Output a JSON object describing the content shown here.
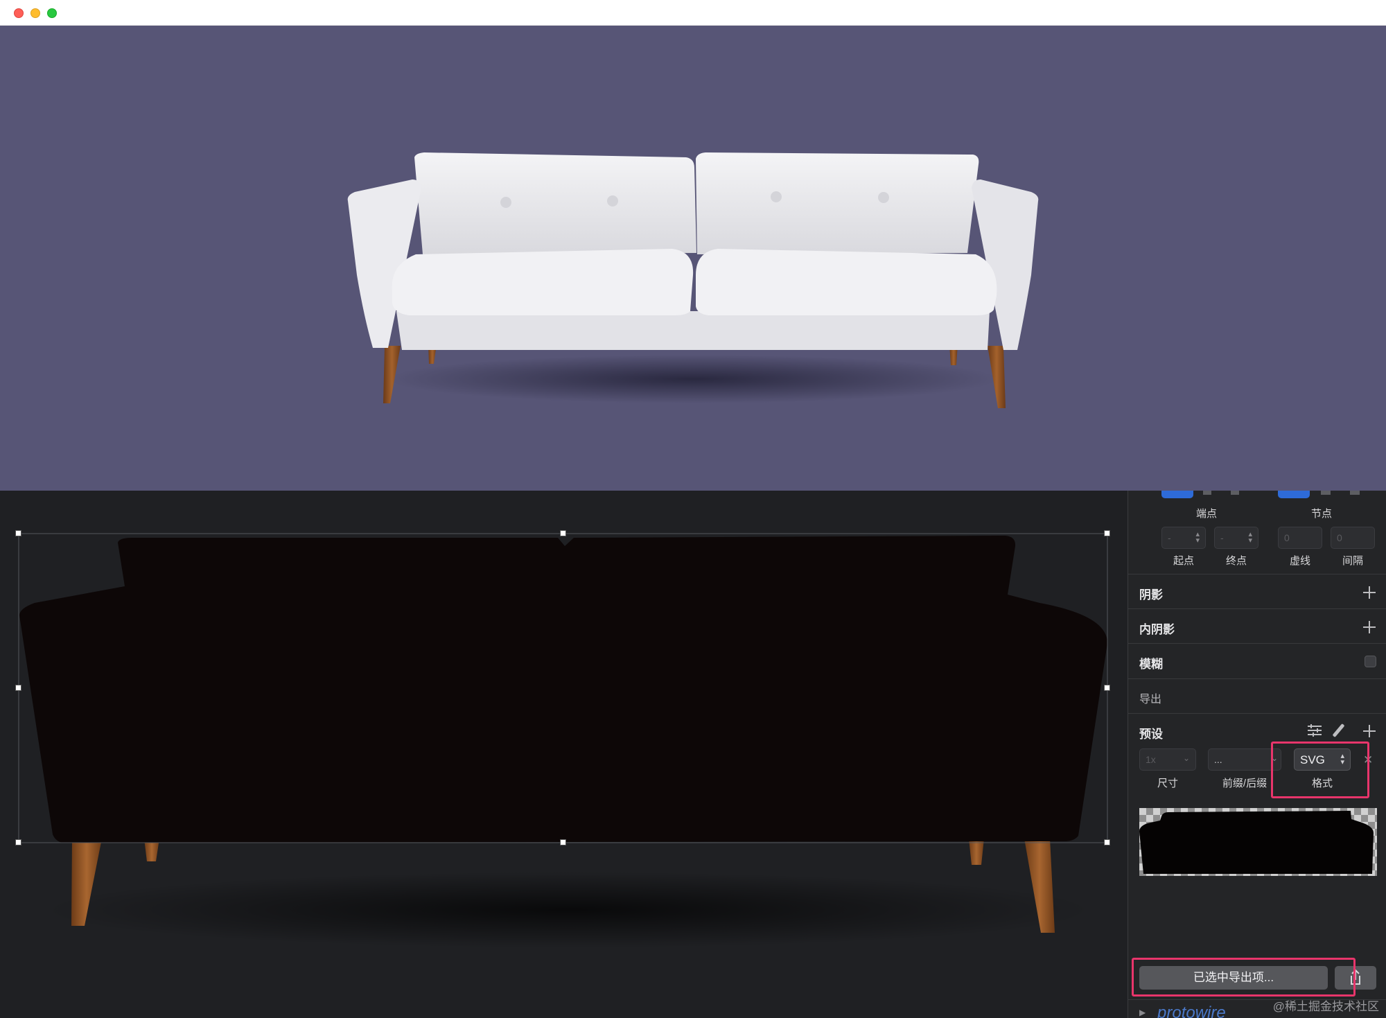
{
  "window": {
    "controls": [
      "close",
      "minimize",
      "maximize"
    ]
  },
  "preview": {
    "background_color": "#575576"
  },
  "inspector": {
    "border_row": {
      "endpoints_label": "端点",
      "nodes_label": "节点"
    },
    "dash_row": {
      "start_label": "起点",
      "start_value": "-",
      "end_label": "终点",
      "end_value": "-",
      "dash_label": "虚线",
      "dash_value": "0",
      "gap_label": "间隔",
      "gap_value": "0"
    },
    "shadow_label": "阴影",
    "inner_shadow_label": "内阴影",
    "blur_label": "模糊",
    "export_label": "导出",
    "preset_label": "预设",
    "export_row": {
      "size_value": "1x",
      "size_label": "尺寸",
      "prefix_value": "...",
      "prefix_label": "前缀/后缀",
      "format_value": "SVG",
      "format_label": "格式"
    },
    "export_selected_button": "已选中导出项...",
    "layer_peek": "protowire"
  },
  "watermark": "@稀土掘金技术社区",
  "colors": {
    "highlight": "#e8356b",
    "canvas_bg": "#1f2023",
    "inspector_bg": "#242527",
    "accent_blue": "#2e6bd8"
  }
}
